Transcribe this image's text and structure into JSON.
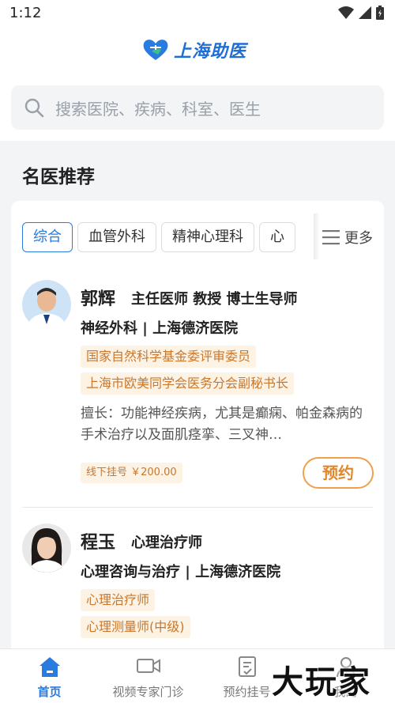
{
  "status_bar": {
    "time": "1:12"
  },
  "app": {
    "name": "上海助医"
  },
  "search": {
    "placeholder": "搜索医院、疾病、科室、医生"
  },
  "section": {
    "title": "名医推荐"
  },
  "tabs": [
    {
      "label": "综合",
      "active": true
    },
    {
      "label": "血管外科",
      "active": false
    },
    {
      "label": "精神心理科",
      "active": false
    },
    {
      "label": "心",
      "active": false
    }
  ],
  "more_label": "更多",
  "doctors": [
    {
      "name": "郭辉",
      "title": "主任医师  教授 博士生导师",
      "dept": "神经外科 | 上海德济医院",
      "tags": [
        "国家自然科学基金委评审委员",
        "上海市欧美同学会医务分会副秘书长"
      ],
      "skill": "擅长：功能神经疾病，尤其是癫痫、帕金森病的手术治疗以及面肌痉挛、三叉神…",
      "fee": "线下挂号 ￥200.00",
      "book_label": "预约"
    },
    {
      "name": "程玉",
      "title": "心理治疗师",
      "dept": "心理咨询与治疗 | 上海德济医院",
      "tags": [
        "心理治疗师",
        "心理测量师(中级)"
      ]
    }
  ],
  "bottom_nav": [
    {
      "label": "首页",
      "icon": "home-icon",
      "active": true
    },
    {
      "label": "视频专家门诊",
      "icon": "video-icon",
      "active": false
    },
    {
      "label": "预约挂号",
      "icon": "register-icon",
      "active": false
    },
    {
      "label": "我的",
      "icon": "user-icon",
      "active": false
    }
  ],
  "watermark": "大玩家",
  "colors": {
    "primary": "#2a7be0",
    "accent": "#f0a04b",
    "tag_bg": "#fdf3e5",
    "tag_text": "#c8772d"
  }
}
